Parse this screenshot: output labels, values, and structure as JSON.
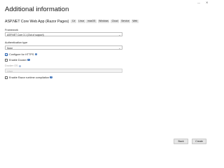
{
  "window": {
    "minimize_icon": "minimize-icon",
    "close_icon": "close-icon",
    "minimize_glyph": "—",
    "close_glyph": "✕"
  },
  "header": {
    "title": "Additional information"
  },
  "project": {
    "name": "ASP.NET Core Web App (Razor Pages)",
    "tags": [
      "C#",
      "Linux",
      "macOS",
      "Windows",
      "Cloud",
      "Service",
      "Web"
    ]
  },
  "form": {
    "framework": {
      "label": "Framework",
      "value": "ASP.NET Core 3.1 (Out of support)"
    },
    "auth": {
      "label": "Authentication type",
      "value": "None"
    },
    "https": {
      "label": "Configure for HTTPS",
      "checked": true
    },
    "docker": {
      "label": "Enable Docker",
      "checked": false
    },
    "docker_os": {
      "label": "Docker OS",
      "value": "Linux"
    },
    "razor": {
      "label": "Enable Razor runtime compilation",
      "checked": false
    }
  },
  "footer": {
    "back_label": "Back",
    "create_label": "Create"
  },
  "colors": {
    "accent": "#3b6fb6",
    "tag_bg": "#e4e4e4",
    "button_bg": "#e6e6e6"
  }
}
